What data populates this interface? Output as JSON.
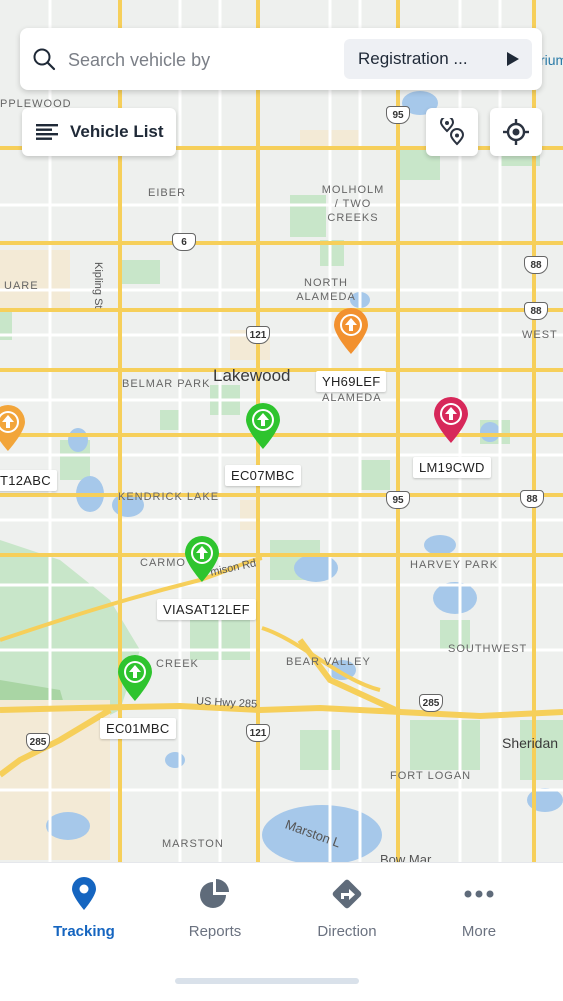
{
  "search": {
    "placeholder": "Search vehicle by",
    "filter_value": "Registration ..."
  },
  "toolbar": {
    "vehicle_list_label": "Vehicle List"
  },
  "map": {
    "city": "Lakewood",
    "labels": [
      "PPLEWOOD",
      "EIBER",
      "MOLHOLM / TWO CREEKS",
      "NORTH ALAMEDA",
      "ALAMEDA",
      "WEST",
      "UARE",
      "BELMAR PARK",
      "KENDRICK LAKE",
      "CARMO",
      "HARVEY PARK",
      "SOUTHWEST",
      "BEAR VALLEY",
      "CREEK",
      "FORT LOGAN",
      "MARSTON",
      "Sheridan",
      "Kipling St",
      "mison Rd",
      "US Hwy 285",
      "Marston L",
      "Bow Mar",
      "rium"
    ],
    "shields": [
      "95",
      "6",
      "88",
      "121",
      "88",
      "95",
      "285",
      "285",
      "121",
      "88"
    ]
  },
  "vehicles": [
    {
      "plate": "YH69LEF",
      "status": "idle",
      "color": "#f2912f"
    },
    {
      "plate": "T12ABC",
      "status": "idle",
      "color": "#f2a53a"
    },
    {
      "plate": "LM19CWD",
      "status": "stopped",
      "color": "#d7285a"
    },
    {
      "plate": "EC07MBC",
      "status": "moving",
      "color": "#2ec42e"
    },
    {
      "plate": "VIASAT12LEF",
      "status": "moving",
      "color": "#2ec42e"
    },
    {
      "plate": "EC01MBC",
      "status": "moving",
      "color": "#2ec42e"
    }
  ],
  "nav": {
    "items": [
      {
        "label": "Tracking",
        "icon": "location-pin-icon",
        "active": true
      },
      {
        "label": "Reports",
        "icon": "pie-chart-icon",
        "active": false
      },
      {
        "label": "Direction",
        "icon": "direction-sign-icon",
        "active": false
      },
      {
        "label": "More",
        "icon": "more-dots-icon",
        "active": false
      }
    ]
  },
  "colors": {
    "accent": "#1565c0",
    "moving": "#2ec42e",
    "idle": "#f2912f",
    "stopped": "#d7285a",
    "road_major": "#f6cf5a"
  }
}
